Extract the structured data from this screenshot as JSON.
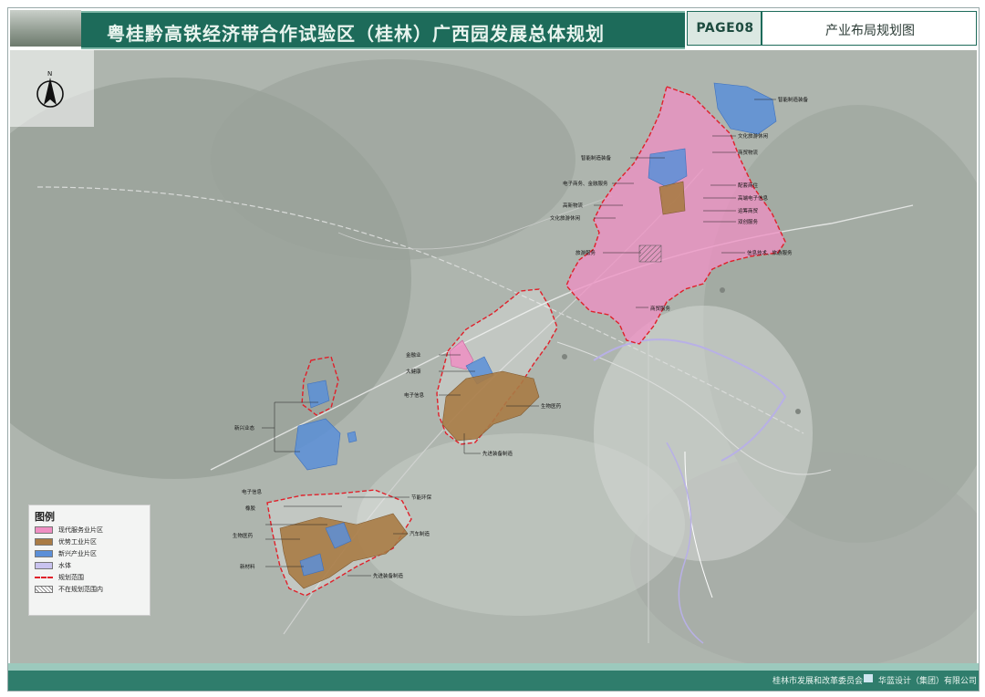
{
  "header": {
    "title": "粤桂黔高铁经济带合作试验区（桂林）广西园发展总体规划",
    "page_no": "PAGE08",
    "drawing_title": "产业布局规划图"
  },
  "north_arrow": {
    "letter": "N",
    "icon": "north-arrow-icon"
  },
  "legend": {
    "title": "图例",
    "items": [
      {
        "label": "现代服务业片区",
        "color": "#ef8fc3"
      },
      {
        "label": "优势工业片区",
        "color": "#a97b45"
      },
      {
        "label": "新兴产业片区",
        "color": "#5b8fd8"
      },
      {
        "label": "水体",
        "color": "#c9c3ef"
      },
      {
        "label": "规划范围",
        "color": "#e0202a"
      },
      {
        "label": "不在规划范围内",
        "color": "#888888"
      }
    ]
  },
  "zone_labels": {
    "znzb_top": "智能制造装备",
    "wenhua_lvyou": "文化旅游休闲",
    "shangmao_wuliu": "商贸物流",
    "znzb_mid": "智能制造装备",
    "peitao_shangzhu": "配套商住",
    "dianzi_shangwu": "电子商务、金融服务",
    "gaoduan_dianzi": "高端电子信息",
    "gaoxin_wuliu": "高新物流",
    "yunshang_shangmao": "运筹商贸",
    "wenhua_lvyou2": "文化旅游休闲",
    "shuangchuang": "双创服务",
    "lvyou_fuwu": "旅游服务",
    "xinxi_jishu": "信息技术、旅游服务",
    "shangmao_fuwu": "商贸服务",
    "jinrongye": "金融业",
    "dajiankang": "大健康",
    "dianzi_xinxi_mid": "电子信息",
    "shengwu_yiyao_mid": "生物医药",
    "xianjin_zhuangbei_mid": "先进装备制造",
    "xinxing_yetai": "新兴业态",
    "dianzi_xinxi_low": "电子信息",
    "jieneng_huanbao": "节能环保",
    "xiangjiao": "橡胶",
    "shengwu_yiyao_low": "生物医药",
    "xincailiao": "新材料",
    "qiche_zhizao": "汽车制造",
    "xianjin_zhuangbei_low": "先进装备制造"
  },
  "footer": {
    "left_org": "桂林市发展和改革委员会",
    "right_org": "华蓝设计（集团）有限公司"
  },
  "colors": {
    "brand_green": "#1d6b5a",
    "service_zone": "#ef8fc3",
    "industry_zone": "#a97b45",
    "emerging_zone": "#5b8fd8",
    "boundary": "#e0202a"
  }
}
